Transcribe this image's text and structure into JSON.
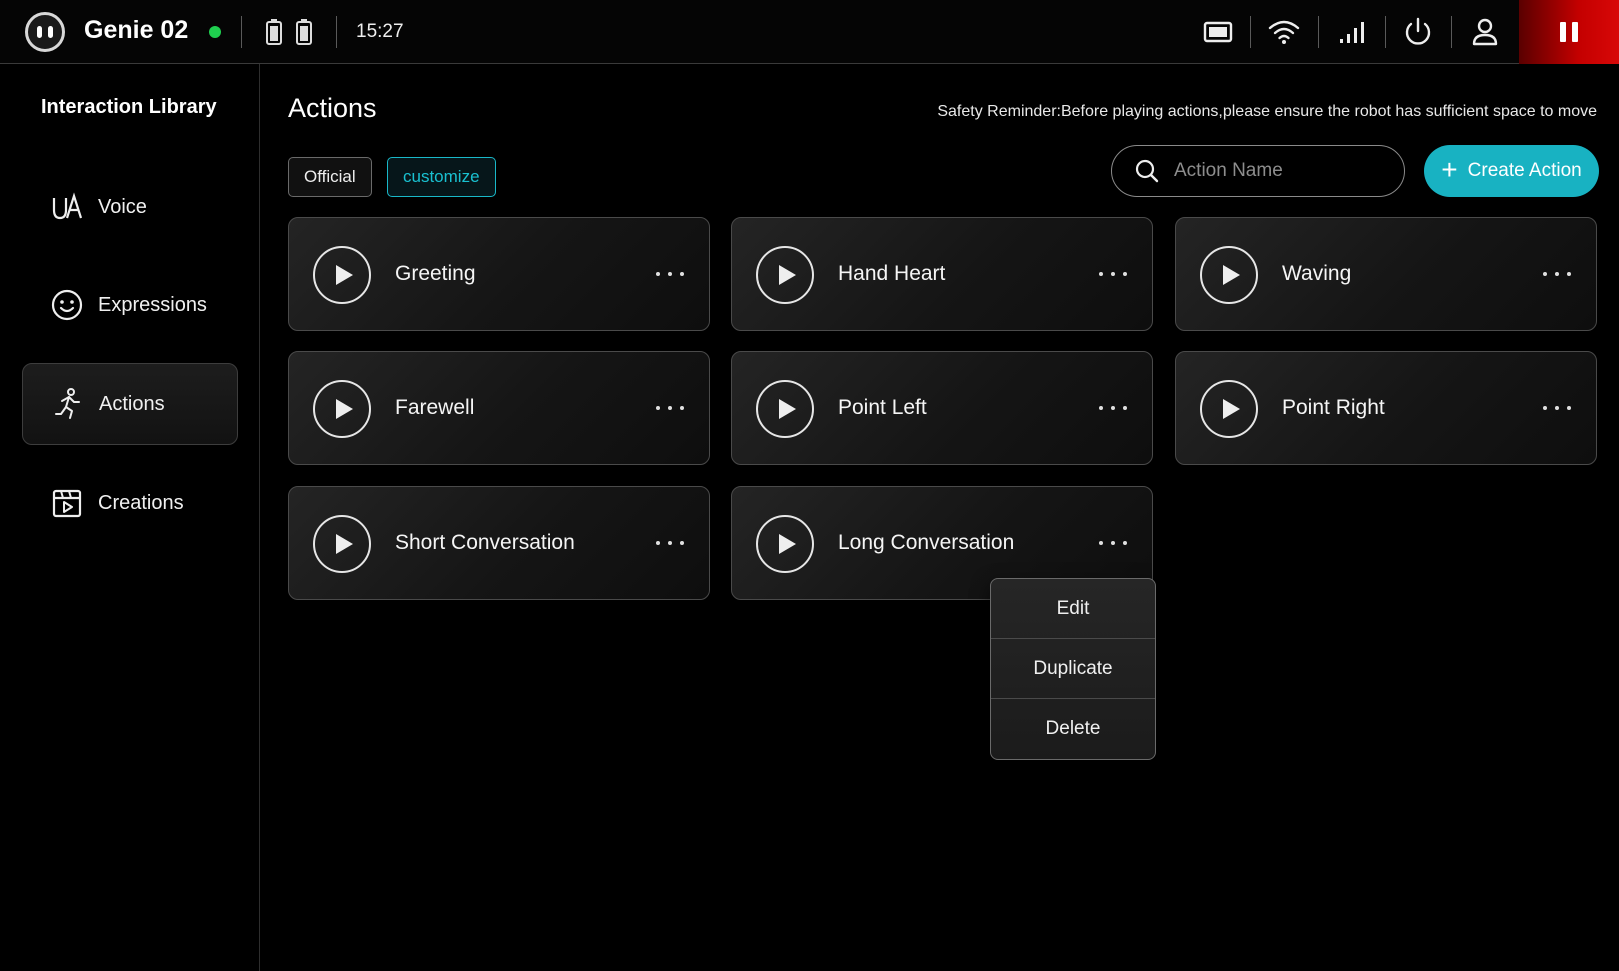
{
  "topbar": {
    "device_name": "Genie 02",
    "online_color": "#1fcf4f",
    "time": "15:27",
    "status_icons": [
      "screen-icon",
      "wifi-icon",
      "signal-icon",
      "power-icon",
      "user-icon"
    ],
    "stop_button_color": "#c40000"
  },
  "sidebar": {
    "title": "Interaction Library",
    "items": [
      {
        "label": "Voice",
        "icon": "voice-icon",
        "active": false
      },
      {
        "label": "Expressions",
        "icon": "smile-icon",
        "active": false
      },
      {
        "label": "Actions",
        "icon": "running-person-icon",
        "active": true
      },
      {
        "label": "Creations",
        "icon": "video-clapper-icon",
        "active": false
      }
    ]
  },
  "main": {
    "title": "Actions",
    "safety_reminder": "Safety Reminder:Before playing actions,please ensure the robot has sufficient space to move",
    "filters": [
      {
        "label": "Official",
        "selected": false
      },
      {
        "label": "customize",
        "selected": true
      }
    ],
    "search": {
      "placeholder": "Action Name",
      "value": ""
    },
    "create_button": "Create Action",
    "accent_color": "#18b2c2",
    "actions": [
      {
        "label": "Greeting"
      },
      {
        "label": "Hand Heart"
      },
      {
        "label": "Waving"
      },
      {
        "label": "Farewell"
      },
      {
        "label": "Point Left"
      },
      {
        "label": "Point Right"
      },
      {
        "label": "Short Conversation"
      },
      {
        "label": "Long Conversation"
      }
    ],
    "context_menu": {
      "items": [
        {
          "label": "Edit"
        },
        {
          "label": "Duplicate"
        },
        {
          "label": "Delete"
        }
      ]
    }
  }
}
